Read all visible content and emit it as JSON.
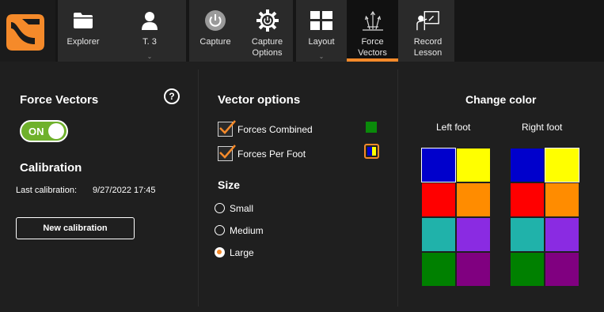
{
  "toolbar": {
    "logo_icon": "app-logo",
    "explorer_label": "Explorer",
    "user_label": "T. 3",
    "capture_label": "Capture",
    "capture_options_label": "Capture\nOptions",
    "layout_label": "Layout",
    "force_vectors_label": "Force\nVectors",
    "record_lesson_label": "Record\nLesson",
    "chevron": "⌄",
    "active_accent": "#f58a2a"
  },
  "force_vectors": {
    "title": "Force Vectors",
    "help": "?",
    "toggle_label": "ON",
    "toggle_color": "#6fb12c",
    "calibration_title": "Calibration",
    "last_calibration_label": "Last calibration:",
    "last_calibration_value": "9/27/2022 17:45",
    "new_calibration_button": "New calibration"
  },
  "vector_options": {
    "title": "Vector options",
    "forces_combined": "Forces Combined",
    "forces_combined_checked": true,
    "forces_combined_color": "#0a8a0a",
    "forces_per_foot": "Forces Per Foot",
    "forces_per_foot_checked": true,
    "size_title": "Size",
    "sizes": [
      "Small",
      "Medium",
      "Large"
    ],
    "selected_size": "Large"
  },
  "change_color": {
    "title": "Change color",
    "left_foot": "Left foot",
    "right_foot": "Right foot",
    "palette": [
      "#0000cc",
      "#ffff00",
      "#ff0000",
      "#ff8c00",
      "#20b2aa",
      "#8a2be2",
      "#008000",
      "#800080"
    ],
    "left_selected": "#0000cc",
    "right_selected": "#ffff00"
  }
}
